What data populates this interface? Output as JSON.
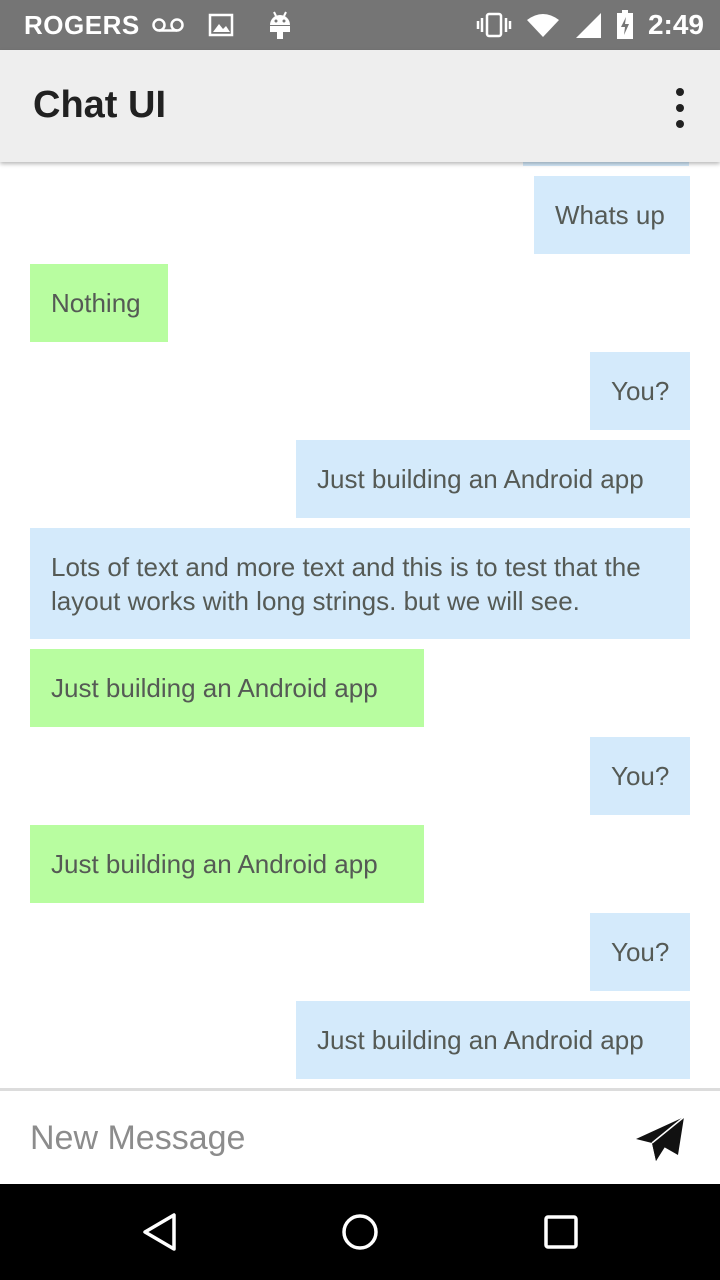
{
  "status_bar": {
    "carrier": "ROGERS",
    "time": "2:49",
    "icons": [
      "voicemail-icon",
      "image-icon",
      "android-icon",
      "vibrate-icon",
      "wifi-icon",
      "signal-icon",
      "battery-charging-icon"
    ]
  },
  "app_bar": {
    "title": "Chat UI",
    "overflow_icon": "more-vert-icon"
  },
  "messages": [
    {
      "text": "",
      "side": "right",
      "color": "blue"
    },
    {
      "text": "Whats up",
      "side": "right",
      "color": "blue"
    },
    {
      "text": "Nothing",
      "side": "left",
      "color": "green"
    },
    {
      "text": "You?",
      "side": "right",
      "color": "blue"
    },
    {
      "text": "Just building an Android app",
      "side": "right",
      "color": "blue"
    },
    {
      "text": "Lots of text and more text and this is to test that the layout works with long strings. but we will see.",
      "side": "full",
      "color": "blue"
    },
    {
      "text": "Just building an Android app",
      "side": "left",
      "color": "green"
    },
    {
      "text": "You?",
      "side": "right",
      "color": "blue"
    },
    {
      "text": "Just building an Android app",
      "side": "left",
      "color": "green"
    },
    {
      "text": "You?",
      "side": "right",
      "color": "blue"
    },
    {
      "text": "Just building an Android app",
      "side": "right",
      "color": "blue"
    }
  ],
  "composer": {
    "placeholder": "New Message",
    "value": "",
    "send_icon": "send-icon"
  },
  "nav_bar": {
    "icons": [
      "back-icon",
      "home-icon",
      "recents-icon"
    ]
  },
  "colors": {
    "status_bar": "#757575",
    "app_bar": "#eeeeee",
    "bubble_blue": "#d4eafb",
    "bubble_green": "#b8fda0",
    "nav_bar": "#000000"
  }
}
